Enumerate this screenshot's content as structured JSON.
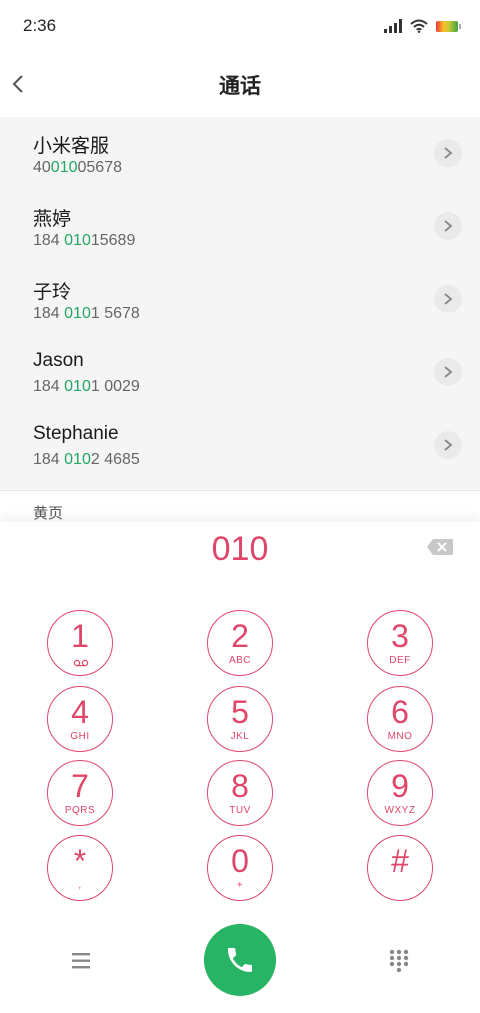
{
  "status": {
    "time": "2:36"
  },
  "header": {
    "title": "通话"
  },
  "contacts": [
    {
      "name": "小米客服",
      "num_pre": "40",
      "num_match": "010",
      "num_post": "05678"
    },
    {
      "name": "燕婷",
      "num_pre": "184 ",
      "num_match": "010",
      "num_post": "15689"
    },
    {
      "name": "子玲",
      "num_pre": "184 ",
      "num_match": "010",
      "num_post": "1 5678"
    },
    {
      "name": "Jason",
      "num_pre": "184 ",
      "num_match": "010",
      "num_post": "1 0029"
    },
    {
      "name": "Stephanie",
      "num_pre": "184 ",
      "num_match": "010",
      "num_post": "2 4685"
    }
  ],
  "section": {
    "yellow_pages": "黄页"
  },
  "dialer": {
    "input": "010",
    "keys": [
      {
        "digit": "1",
        "letters": ""
      },
      {
        "digit": "2",
        "letters": "ABC"
      },
      {
        "digit": "3",
        "letters": "DEF"
      },
      {
        "digit": "4",
        "letters": "GHI"
      },
      {
        "digit": "5",
        "letters": "JKL"
      },
      {
        "digit": "6",
        "letters": "MNO"
      },
      {
        "digit": "7",
        "letters": "PQRS"
      },
      {
        "digit": "8",
        "letters": "TUV"
      },
      {
        "digit": "9",
        "letters": "WXYZ"
      },
      {
        "digit": "*",
        "letters": ","
      },
      {
        "digit": "0",
        "letters": "+"
      },
      {
        "digit": "#",
        "letters": ""
      }
    ]
  },
  "colors": {
    "accent": "#e0456a",
    "match": "#22a863",
    "call": "#27b464"
  },
  "icons": [
    "signal-icon",
    "wifi-icon",
    "battery-icon",
    "back-arrow-icon",
    "chevron-right-icon",
    "backspace-icon",
    "voicemail-icon",
    "menu-icon",
    "phone-icon",
    "keypad-icon"
  ]
}
